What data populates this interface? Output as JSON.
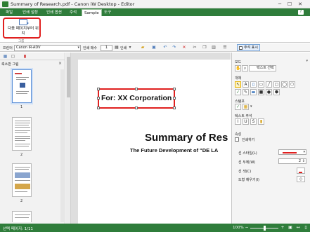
{
  "window": {
    "title": "Summary of Research.pdf - Canon iW Desktop - Editor",
    "minimize_glyph": "─",
    "maximize_glyph": "☐",
    "close_glyph": "✕"
  },
  "ribbon": {
    "tabs": [
      {
        "label": "파일",
        "active": false
      },
      {
        "label": "인쇄 설정",
        "active": false
      },
      {
        "label": "인쇄 옵션",
        "active": false
      },
      {
        "label": "주석",
        "active": false
      },
      {
        "label": "Sample",
        "active": true
      },
      {
        "label": "도구",
        "active": false
      }
    ],
    "help_label": "?",
    "button": {
      "label_line1": "다음 페이지부터 위",
      "label_line2": "치",
      "icon": "next-page-position-icon"
    },
    "group_label": "그룹"
  },
  "toolbar": {
    "printer_label": "프린터",
    "printer_value": "Canon iR-ADV",
    "copies_label": "인쇄 매수",
    "copies_value": "1",
    "print_label": "인쇄",
    "annotation_toggle_label": "주석 표시",
    "accent_color": "#2f7d3b"
  },
  "left_panel": {
    "title": "축소판 그림",
    "close_glyph": "×",
    "thumbnails": [
      {
        "number": "1",
        "selected": true
      },
      {
        "number": "2",
        "selected": false
      },
      {
        "number": "2",
        "selected": false
      }
    ]
  },
  "document": {
    "stamp_text": "For: XX Corporation",
    "title": "Summary of Res",
    "subtitle": "The Future Development of \"DE LA",
    "selection_color": "#e0201f"
  },
  "right_panel": {
    "mode_section": "모드",
    "select_text_label": "텍스트 선택",
    "object_section": "개체",
    "stamp_section": "스탬프",
    "text_annotation_section": "텍스트 주석",
    "properties_section": "속성",
    "prop_print_label": "인쇄하기",
    "line_style_label": "선 스타일(L)",
    "line_width_label": "선 두께(W)",
    "line_width_value": "2",
    "line_color_label": "선 색(C)",
    "fill_color_label": "도형 채우기(I)",
    "line_color": "#e0201f"
  },
  "status": {
    "page_text": "선택 페이지: 1/11",
    "zoom": "100%"
  }
}
